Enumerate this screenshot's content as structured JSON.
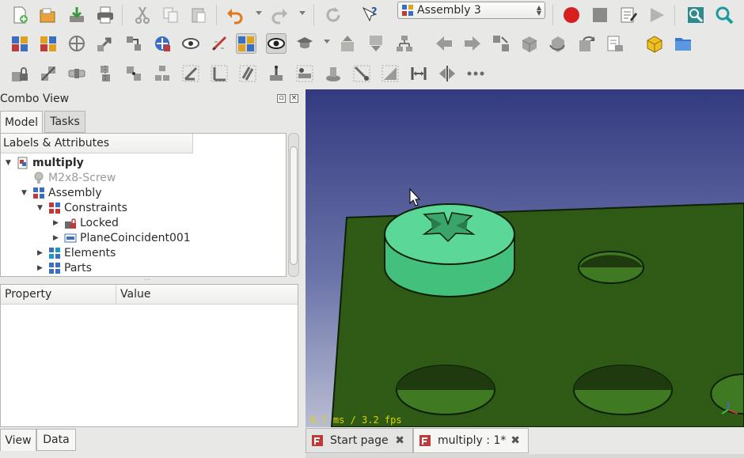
{
  "toolbar": {
    "workbench_select": "Assembly 3"
  },
  "combo_view": {
    "title": "Combo View",
    "tabs": [
      "Model",
      "Tasks"
    ],
    "tree_header": "Labels & Attributes",
    "tree": [
      {
        "label": "multiply",
        "level": 0,
        "expand": "open",
        "icon": "document-icon",
        "style": "bold"
      },
      {
        "label": "M2x8-Screw",
        "level": 1,
        "expand": "none",
        "icon": "screw-part-icon",
        "style": "dim"
      },
      {
        "label": "Assembly",
        "level": 1,
        "expand": "open",
        "icon": "assembly-icon",
        "style": "normal"
      },
      {
        "label": "Constraints",
        "level": 2,
        "expand": "open",
        "icon": "constraints-icon",
        "style": "normal"
      },
      {
        "label": "Locked",
        "level": 3,
        "expand": "closed",
        "icon": "lock-constraint-icon",
        "style": "normal"
      },
      {
        "label": "PlaneCoincident001",
        "level": 3,
        "expand": "closed",
        "icon": "plane-coincident-icon",
        "style": "normal"
      },
      {
        "label": "Elements",
        "level": 2,
        "expand": "closed",
        "icon": "elements-icon",
        "style": "normal"
      },
      {
        "label": "Parts",
        "level": 2,
        "expand": "closed",
        "icon": "parts-icon",
        "style": "normal"
      }
    ],
    "property_header": {
      "property": "Property",
      "value": "Value"
    },
    "bottom_tabs": [
      "View",
      "Data"
    ]
  },
  "viewport": {
    "fps_text": "6.7 ms / 3.2 fps"
  },
  "document_tabs": [
    {
      "label": "Start page",
      "active": false
    },
    {
      "label": "multiply : 1*",
      "active": true
    }
  ],
  "colors": {
    "plate": "#2f5a16",
    "screw": "#4fd08b",
    "viewport_top": "#333b80",
    "viewport_bottom": "#b9bdd3",
    "fps": "#e0d400"
  }
}
